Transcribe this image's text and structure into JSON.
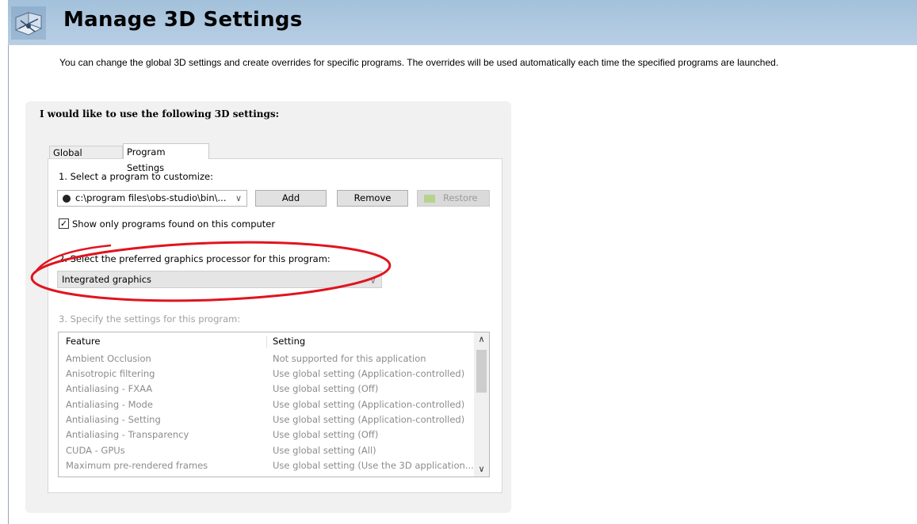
{
  "header": {
    "title": "Manage 3D Settings",
    "icon": "nvidia-3d-cube-icon"
  },
  "description": "You can change the global 3D settings and create overrides for specific programs. The overrides will be used automatically each time the specified programs are launched.",
  "panel": {
    "heading": "I would like to use the following 3D settings:",
    "tabs": [
      {
        "label": "Global Settings"
      },
      {
        "label": "Program Settings",
        "active": true
      }
    ],
    "step1": {
      "label": "1. Select a program to customize:",
      "program_value": "c:\\program files\\obs-studio\\bin\\...",
      "add_label": "Add",
      "remove_label": "Remove",
      "restore_label": "Restore"
    },
    "show_only_label": "Show only programs found on this computer",
    "show_only_checked": true,
    "step2": {
      "label": "2. Select the preferred graphics processor for this program:",
      "value": "Integrated graphics"
    },
    "step3": {
      "label": "3. Specify the settings for this program:",
      "columns": [
        "Feature",
        "Setting"
      ],
      "rows": [
        {
          "feature": "Ambient Occlusion",
          "setting": "Not supported for this application"
        },
        {
          "feature": "Anisotropic filtering",
          "setting": "Use global setting (Application-controlled)"
        },
        {
          "feature": "Antialiasing - FXAA",
          "setting": "Use global setting (Off)"
        },
        {
          "feature": "Antialiasing - Mode",
          "setting": "Use global setting (Application-controlled)"
        },
        {
          "feature": "Antialiasing - Setting",
          "setting": "Use global setting (Application-controlled)"
        },
        {
          "feature": "Antialiasing - Transparency",
          "setting": "Use global setting (Off)"
        },
        {
          "feature": "CUDA - GPUs",
          "setting": "Use global setting (All)"
        },
        {
          "feature": "Maximum pre-rendered frames",
          "setting": "Use global setting (Use the 3D application..."
        }
      ]
    }
  },
  "colors": {
    "header_bg": "#a3c1db",
    "annotation": "#e0141e",
    "panel_bg": "#f1f1f1"
  }
}
